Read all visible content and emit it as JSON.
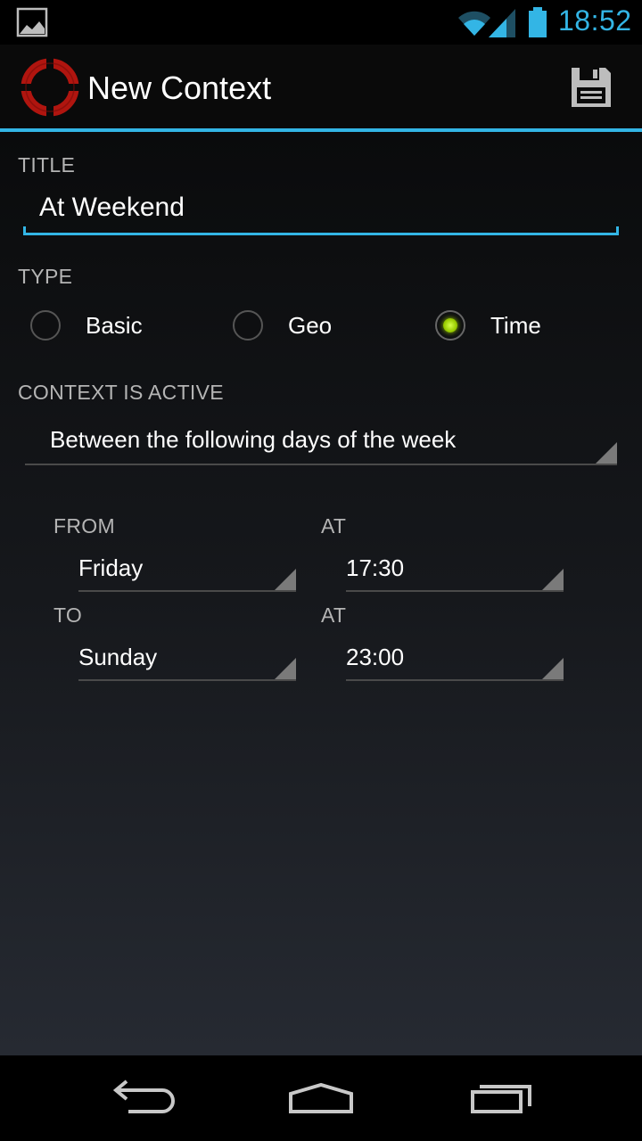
{
  "status_bar": {
    "time": "18:52",
    "icons": [
      "image-notification-icon",
      "wifi-icon",
      "signal-icon",
      "battery-icon"
    ],
    "accent_color": "#33b5e5"
  },
  "action_bar": {
    "title": "New Context",
    "logo_icon": "lifebuoy-logo-icon",
    "save_icon": "floppy-disk-save-icon"
  },
  "form": {
    "title_label": "TITLE",
    "title_value": "At Weekend",
    "type_label": "TYPE",
    "type_options": [
      {
        "label": "Basic",
        "checked": false
      },
      {
        "label": "Geo",
        "checked": false
      },
      {
        "label": "Time",
        "checked": true
      }
    ],
    "context_active_label": "CONTEXT IS ACTIVE",
    "context_active_value": "Between the following days of the week",
    "from_label": "FROM",
    "from_day": "Friday",
    "from_at_label": "AT",
    "from_time": "17:30",
    "to_label": "TO",
    "to_day": "Sunday",
    "to_at_label": "AT",
    "to_time": "23:00"
  },
  "nav_bar": {
    "icons": [
      "back-icon",
      "home-icon",
      "recent-apps-icon"
    ]
  }
}
